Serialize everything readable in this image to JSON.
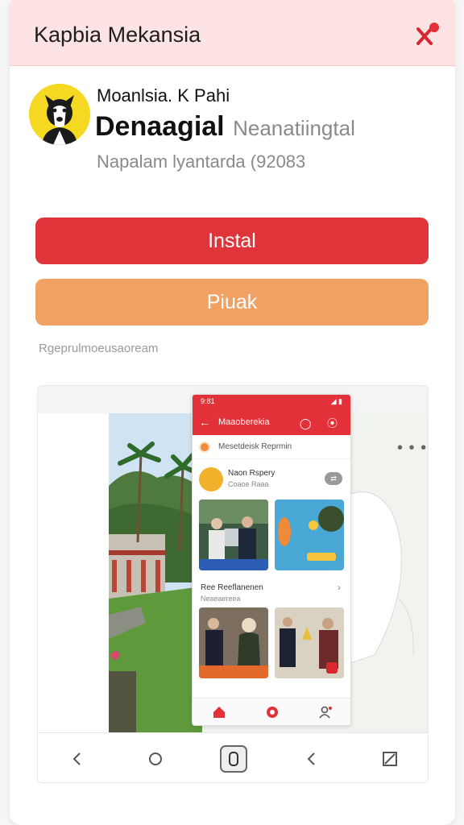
{
  "dialog": {
    "title": "Kapbia Mekansia"
  },
  "app": {
    "developer_line": "Moanlsia. K Pahi",
    "name_bold": "Denaagial",
    "name_light": "Neanatiingtal",
    "meta": "Napalam lyantarda (92083"
  },
  "buttons": {
    "install_label": "Instal",
    "secondary_label": "Piuak"
  },
  "caption": "Rgeprulmoeusaoream",
  "preview": {
    "more_label": "• • •",
    "phone": {
      "status_time": "9:81",
      "status_icons": "◢ ▮",
      "appbar_title": "Maaoberekia",
      "appbar_actions": "◯ ⦿",
      "notice": "Mesetdeisk Reprmin",
      "profile_name": "Naon Rspery",
      "profile_sub": "Coaoe Raaa",
      "pill": "⇄",
      "section_title": "Ree Reeflanenen",
      "section_sub": "Neaeaereea",
      "section_arrow": "›",
      "card_badge": "▬"
    }
  },
  "colors": {
    "titlebar_bg": "#fde3e3",
    "install": "#e0343b",
    "secondary": "#f0a163",
    "accent_red": "#e23138",
    "avatar_bg": "#f5d821"
  },
  "icons": {
    "close": "close-icon",
    "back": "back-icon",
    "home": "home-icon",
    "overview": "overview-icon",
    "forward": "forward-icon",
    "expand": "expand-icon"
  }
}
